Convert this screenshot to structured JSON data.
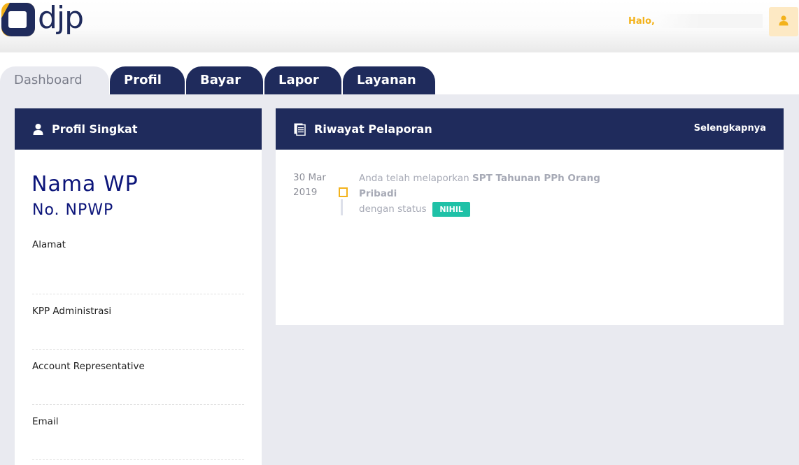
{
  "header": {
    "logo_text": "djp",
    "greeting": "Halo,",
    "user_icon": "user-icon"
  },
  "tabs": [
    {
      "label": "Dashboard",
      "active": true
    },
    {
      "label": "Profil",
      "active": false
    },
    {
      "label": "Bayar",
      "active": false
    },
    {
      "label": "Lapor",
      "active": false
    },
    {
      "label": "Layanan",
      "active": false
    }
  ],
  "profil": {
    "title": "Profil Singkat",
    "icon": "user-icon",
    "nama": "Nama WP",
    "npwp": "No. NPWP",
    "fields": [
      "Alamat",
      "KPP Administrasi",
      "Account Representative",
      "Email"
    ]
  },
  "riwayat": {
    "title": "Riwayat Pelaporan",
    "icon": "document-icon",
    "more_label": "Selengkapnya",
    "entry": {
      "date_line1": "30 Mar",
      "date_line2": "2019",
      "text_prefix": "Anda telah melaporkan ",
      "text_bold": "SPT Tahunan PPh Orang Pribadi",
      "text_suffix": "dengan status",
      "status": "NIHIL"
    }
  },
  "colors": {
    "navy": "#1f2b5c",
    "accent": "#f3b21b",
    "badge": "#1fc1a7",
    "background": "#e9eaf0"
  }
}
